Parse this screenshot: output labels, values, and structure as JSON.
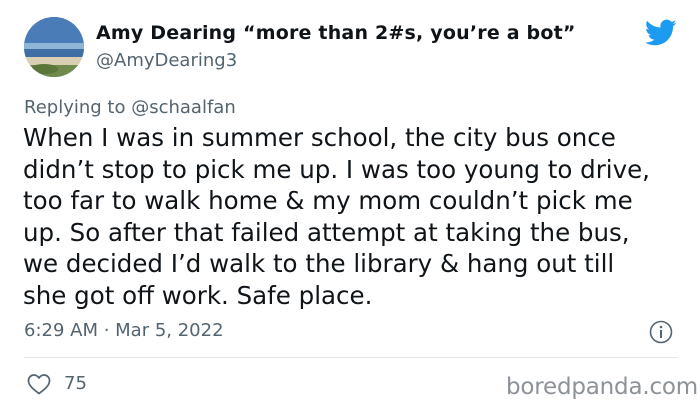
{
  "author": {
    "display_name": "Amy Dearing “more than 2#s, you’re a bot”",
    "handle": "@AmyDearing3",
    "avatar_icon": "avatar-beach-photo"
  },
  "reply": {
    "prefix": "Replying to",
    "mention": "@schaalfan"
  },
  "tweet": {
    "lines": [
      "When I was in summer school, the city bus once",
      "didn’t stop to pick me up. I was too young to drive,",
      "too far to walk home & my mom couldn’t pick me",
      "up. So after that failed attempt at taking the bus,",
      "we decided I’d walk to the library & hang out till",
      "she got off work. Safe place."
    ]
  },
  "meta": {
    "timestamp": "6:29 AM · Mar 5, 2022",
    "likes": "75"
  },
  "icons": {
    "brand": "twitter-bird-icon",
    "info": "info-icon",
    "like": "heart-icon"
  },
  "colors": {
    "twitter_blue": "#1d9bf0",
    "secondary_text": "#536471"
  },
  "watermark": "boredpanda.com"
}
